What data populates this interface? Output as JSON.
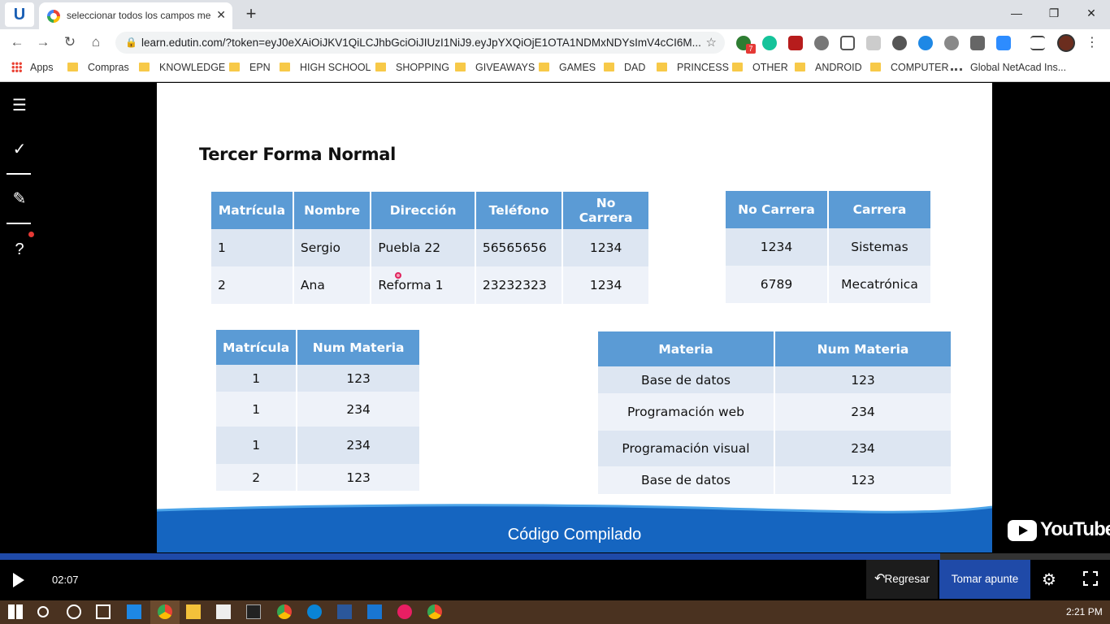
{
  "browser": {
    "tab_title": "seleccionar todos los campos me",
    "tab_close": "✕",
    "new_tab": "+",
    "url": "learn.edutin.com/?token=eyJ0eXAiOiJKV1QiLCJhbGciOiJIUzI1NiJ9.eyJpYXQiOjE1OTA1NDMxNDYsImV4cCI6M...",
    "window_controls": [
      "—",
      "❐",
      "✕"
    ],
    "nav_icons": [
      "arrow-left-icon",
      "arrow-right-icon",
      "reload-icon",
      "home-icon"
    ],
    "extension_badge": "7"
  },
  "bookmarks": [
    {
      "label": "Apps",
      "icon": "apps-grid-icon"
    },
    {
      "label": "Compras",
      "icon": "folder-icon"
    },
    {
      "label": "KNOWLEDGE",
      "icon": "folder-icon"
    },
    {
      "label": "EPN",
      "icon": "folder-icon"
    },
    {
      "label": "HIGH SCHOOL",
      "icon": "folder-icon"
    },
    {
      "label": "SHOPPING",
      "icon": "folder-icon"
    },
    {
      "label": "GIVEAWAYS",
      "icon": "folder-icon"
    },
    {
      "label": "GAMES",
      "icon": "folder-icon"
    },
    {
      "label": "DAD",
      "icon": "folder-icon"
    },
    {
      "label": "PRINCESS",
      "icon": "folder-icon"
    },
    {
      "label": "OTHER",
      "icon": "folder-icon"
    },
    {
      "label": "ANDROID",
      "icon": "folder-icon"
    },
    {
      "label": "COMPUTER",
      "icon": "folder-icon"
    },
    {
      "label": "Global NetAcad Ins...",
      "icon": "cisco-icon"
    }
  ],
  "app_logo": "U",
  "slide": {
    "title": "Tercer Forma Normal",
    "footer": "Código Compilado",
    "table1": {
      "headers": [
        "Matrícula",
        "Nombre",
        "Dirección",
        "Teléfono",
        "No Carrera"
      ],
      "rows": [
        [
          "1",
          "Sergio",
          "Puebla 22",
          "56565656",
          "1234"
        ],
        [
          "2",
          "Ana",
          "Reforma 1",
          "23232323",
          "1234"
        ]
      ]
    },
    "table2": {
      "headers": [
        "No Carrera",
        "Carrera"
      ],
      "rows": [
        [
          "1234",
          "Sistemas"
        ],
        [
          "6789",
          "Mecatrónica"
        ]
      ]
    },
    "table3": {
      "headers": [
        "Matrícula",
        "Num Materia"
      ],
      "rows": [
        [
          "1",
          "123"
        ],
        [
          "1",
          "234"
        ],
        [
          "1",
          "234"
        ],
        [
          "2",
          "123"
        ]
      ]
    },
    "table4": {
      "headers": [
        "Materia",
        "Num Materia"
      ],
      "rows": [
        [
          "Base de datos",
          "123"
        ],
        [
          "Programación web",
          "234"
        ],
        [
          "Programación visual",
          "234"
        ],
        [
          "Base de datos",
          "123"
        ]
      ]
    }
  },
  "youtube_logo": "YouTube",
  "player": {
    "time": "02:07",
    "progress_fraction": 0.847,
    "back_label": "Regresar",
    "note_label": "Tomar apunte"
  },
  "colors": {
    "table_header": "#5b9bd5",
    "accent": "#1f4aa8",
    "footer_wave": "#1565c0"
  },
  "taskbar": {
    "clock": "2:21 PM"
  }
}
